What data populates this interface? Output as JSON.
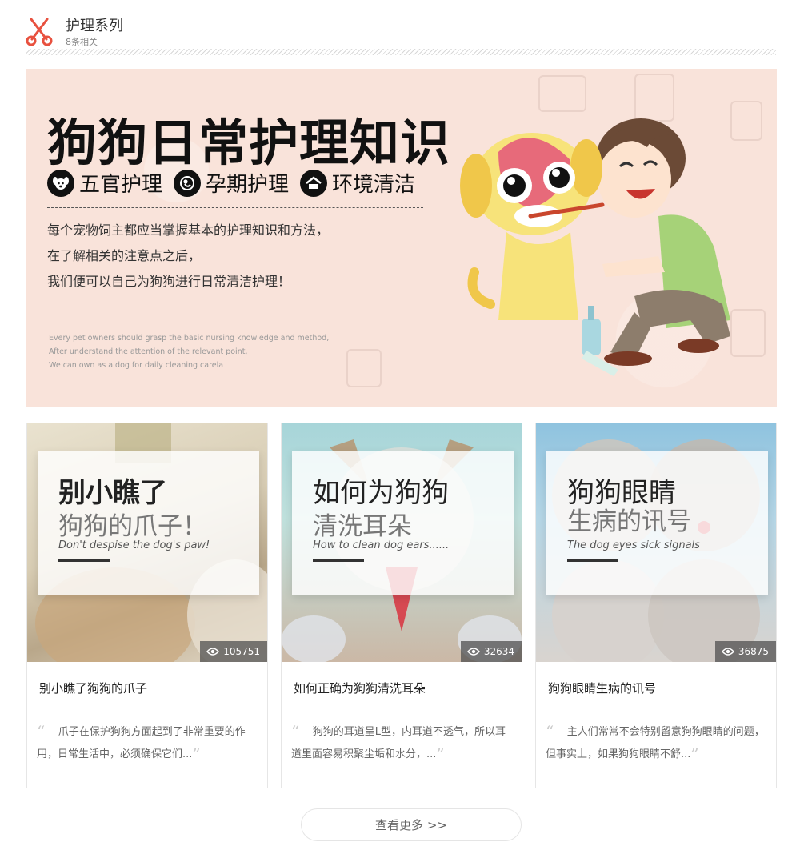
{
  "header": {
    "title": "护理系列",
    "count": "8条相关",
    "icon": "scissors-icon",
    "accent": "#e8513f"
  },
  "banner": {
    "title": "狗狗日常护理知识",
    "tags": [
      "五官护理",
      "孕期护理",
      "环境清洁"
    ],
    "lines": [
      "每个宠物饲主都应当掌握基本的护理知识和方法，",
      "在了解相关的注意点之后，",
      "我们便可以自己为狗狗进行日常清洁护理！"
    ],
    "en_lines": [
      "Every pet owners should grasp the basic nursing knowledge and method,",
      "After understand the attention of the relevant point,",
      "We can own as a dog for daily cleaning carela"
    ]
  },
  "cards": [
    {
      "overlay1": "别小瞧了",
      "overlay2": "狗狗的爪子！",
      "overlay3": "Don't despise the dog's paw!",
      "views": "105751",
      "title": "别小瞧了狗狗的爪子",
      "desc": "爪子在保护狗狗方面起到了非常重要的作用，日常生活中，必须确保它们..."
    },
    {
      "overlay1": "如何为狗狗",
      "overlay2": "清洗耳朵",
      "overlay3": "How to clean dog ears......",
      "views": "32634",
      "title": "如何正确为狗狗清洗耳朵",
      "desc": "狗狗的耳道呈L型，内耳道不透气，所以耳道里面容易积聚尘垢和水分，..."
    },
    {
      "overlay1": "狗狗眼睛",
      "overlay2": "生病的讯号",
      "overlay3": "The dog  eyes sick signals",
      "views": "36875",
      "title": "狗狗眼睛生病的讯号",
      "desc": "主人们常常不会特别留意狗狗眼睛的问题，但事实上，如果狗狗眼睛不舒..."
    }
  ],
  "more_label": "查看更多 >>"
}
